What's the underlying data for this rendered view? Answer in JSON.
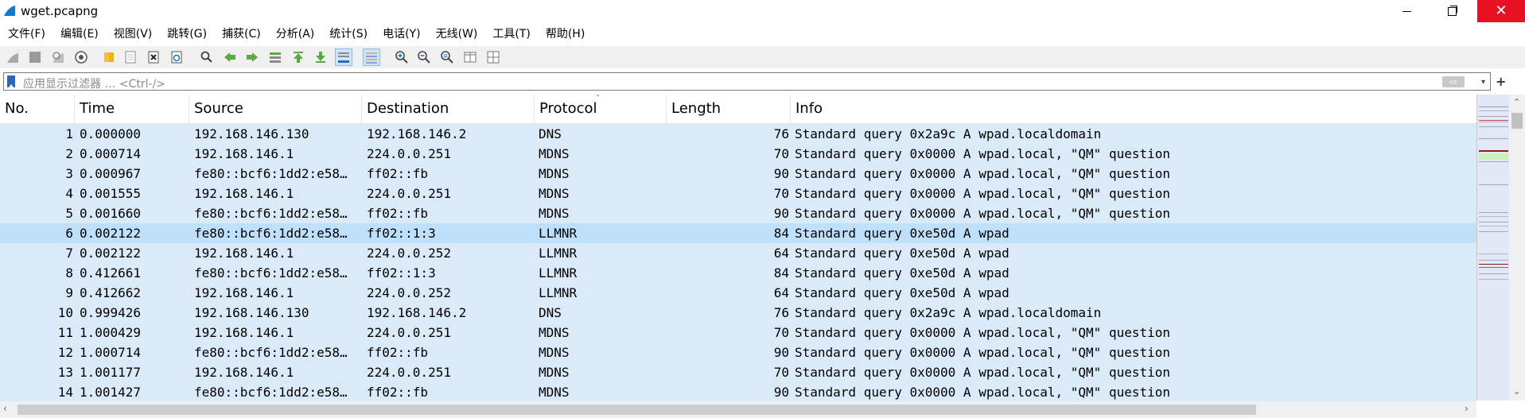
{
  "window": {
    "title": "wget.pcapng",
    "icon": "wireshark-fin-icon",
    "controls": {
      "minimize": "minimize-icon",
      "maximize": "restore-icon",
      "close": "close-icon"
    },
    "close_glyph": "✕"
  },
  "menu": [
    "文件(F)",
    "编辑(E)",
    "视图(V)",
    "跳转(G)",
    "捕获(C)",
    "分析(A)",
    "统计(S)",
    "电话(Y)",
    "无线(W)",
    "工具(T)",
    "帮助(H)"
  ],
  "toolbar": {
    "icons": [
      "start-capture-icon",
      "stop-capture-icon",
      "restart-capture-icon",
      "capture-options-icon",
      "open-file-icon",
      "save-file-icon",
      "close-file-icon",
      "reload-file-icon",
      "find-packet-icon",
      "go-back-icon",
      "go-forward-icon",
      "go-to-packet-icon",
      "go-first-packet-icon",
      "go-last-packet-icon",
      "auto-scroll-icon",
      "colorize-icon",
      "zoom-in-icon",
      "zoom-out-icon",
      "zoom-normal-icon",
      "resize-columns-icon",
      "layout-icon"
    ]
  },
  "filter": {
    "placeholder": "应用显示过滤器 … <Ctrl-/>",
    "apply_glyph": "⇨",
    "dropdown_glyph": "▾",
    "add_glyph": "+"
  },
  "packet_list": {
    "columns": [
      "No.",
      "Time",
      "Source",
      "Destination",
      "Protocol",
      "Length",
      "Info"
    ],
    "sort_glyph": "ˇ",
    "rows": [
      {
        "no": "1",
        "time": "0.000000",
        "source": "192.168.146.130",
        "destination": "192.168.146.2",
        "protocol": "DNS",
        "length": "76",
        "info": "Standard query 0x2a9c A wpad.localdomain"
      },
      {
        "no": "2",
        "time": "0.000714",
        "source": "192.168.146.1",
        "destination": "224.0.0.251",
        "protocol": "MDNS",
        "length": "70",
        "info": "Standard query 0x0000 A wpad.local, \"QM\" question"
      },
      {
        "no": "3",
        "time": "0.000967",
        "source": "fe80::bcf6:1dd2:e58…",
        "destination": "ff02::fb",
        "protocol": "MDNS",
        "length": "90",
        "info": "Standard query 0x0000 A wpad.local, \"QM\" question"
      },
      {
        "no": "4",
        "time": "0.001555",
        "source": "192.168.146.1",
        "destination": "224.0.0.251",
        "protocol": "MDNS",
        "length": "70",
        "info": "Standard query 0x0000 A wpad.local, \"QM\" question"
      },
      {
        "no": "5",
        "time": "0.001660",
        "source": "fe80::bcf6:1dd2:e58…",
        "destination": "ff02::fb",
        "protocol": "MDNS",
        "length": "90",
        "info": "Standard query 0x0000 A wpad.local, \"QM\" question"
      },
      {
        "no": "6",
        "time": "0.002122",
        "source": "fe80::bcf6:1dd2:e58…",
        "destination": "ff02::1:3",
        "protocol": "LLMNR",
        "length": "84",
        "info": "Standard query 0xe50d A wpad",
        "selected": true
      },
      {
        "no": "7",
        "time": "0.002122",
        "source": "192.168.146.1",
        "destination": "224.0.0.252",
        "protocol": "LLMNR",
        "length": "64",
        "info": "Standard query 0xe50d A wpad"
      },
      {
        "no": "8",
        "time": "0.412661",
        "source": "fe80::bcf6:1dd2:e58…",
        "destination": "ff02::1:3",
        "protocol": "LLMNR",
        "length": "84",
        "info": "Standard query 0xe50d A wpad"
      },
      {
        "no": "9",
        "time": "0.412662",
        "source": "192.168.146.1",
        "destination": "224.0.0.252",
        "protocol": "LLMNR",
        "length": "64",
        "info": "Standard query 0xe50d A wpad"
      },
      {
        "no": "10",
        "time": "0.999426",
        "source": "192.168.146.130",
        "destination": "192.168.146.2",
        "protocol": "DNS",
        "length": "76",
        "info": "Standard query 0x2a9c A wpad.localdomain"
      },
      {
        "no": "11",
        "time": "1.000429",
        "source": "192.168.146.1",
        "destination": "224.0.0.251",
        "protocol": "MDNS",
        "length": "70",
        "info": "Standard query 0x0000 A wpad.local, \"QM\" question"
      },
      {
        "no": "12",
        "time": "1.000714",
        "source": "fe80::bcf6:1dd2:e58…",
        "destination": "ff02::fb",
        "protocol": "MDNS",
        "length": "90",
        "info": "Standard query 0x0000 A wpad.local, \"QM\" question"
      },
      {
        "no": "13",
        "time": "1.001177",
        "source": "192.168.146.1",
        "destination": "224.0.0.251",
        "protocol": "MDNS",
        "length": "70",
        "info": "Standard query 0x0000 A wpad.local, \"QM\" question"
      },
      {
        "no": "14",
        "time": "1.001427",
        "source": "fe80::bcf6:1dd2:e58…",
        "destination": "ff02::fb",
        "protocol": "MDNS",
        "length": "90",
        "info": "Standard query 0x0000 A wpad.local, \"QM\" question"
      }
    ]
  },
  "colors": {
    "row_bg": "#dbeaf8",
    "row_selected_bg": "#bfe0fa",
    "close_button": "#e81123",
    "minimap_bg": "#e2e8f5"
  }
}
